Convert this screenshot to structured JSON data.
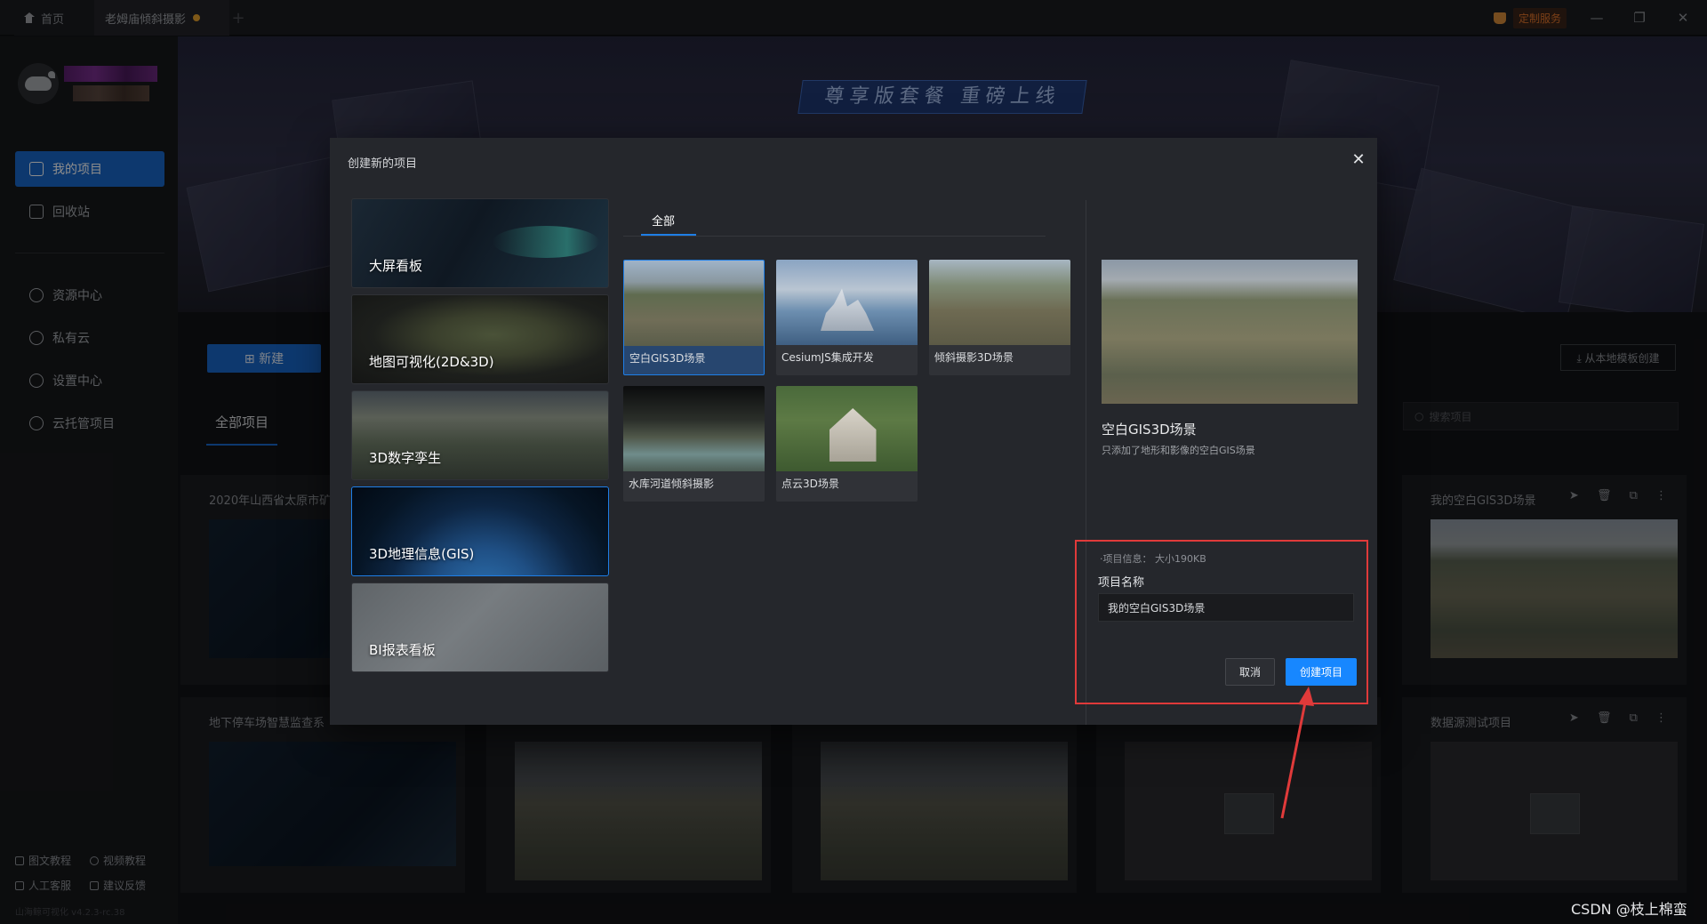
{
  "titlebar": {
    "home_tab": "首页",
    "doc_tab": "老姆庙倾斜摄影",
    "service_label": "定制服务",
    "min_icon": "—",
    "restore_icon": "❐",
    "close_icon": "✕",
    "accent_color": "#1966c9"
  },
  "sidebar": {
    "nav": [
      {
        "label": "我的项目",
        "icon": "monitor-icon"
      },
      {
        "label": "回收站",
        "icon": "trash-icon"
      },
      {
        "label": "资源中心",
        "icon": "cube-icon"
      },
      {
        "label": "私有云",
        "icon": "cloud-icon"
      },
      {
        "label": "设置中心",
        "icon": "gear-icon"
      },
      {
        "label": "云托管项目",
        "icon": "cloud-upload-icon"
      }
    ],
    "footer": {
      "tutorial_text": "图文教程",
      "tutorial_video": "视频教程",
      "support": "人工客服",
      "feedback": "建议反馈",
      "version": "山海鲸可视化 v4.2.3-rc.38"
    }
  },
  "banner": {
    "title": "尊享版套餐 重磅上线"
  },
  "main": {
    "new_button": "⊞ 新建",
    "template_button": "⤓ 从本地模板创建",
    "tab_all": "全部项目",
    "search_placeholder": "搜索项目",
    "projects": [
      {
        "title": "2020年山西省太原市矿"
      },
      {
        "title": "我的空白GIS3D场景"
      },
      {
        "title": "地下停车场智慧监查系"
      },
      {
        "title": "数据源测试项目"
      }
    ],
    "project_actions": "➤ 🗑 ⧉ ⋮"
  },
  "modal": {
    "title": "创建新的项目",
    "close_icon": "✕",
    "categories": [
      {
        "label": "大屏看板"
      },
      {
        "label": "地图可视化(2D&3D)"
      },
      {
        "label": "3D数字孪生"
      },
      {
        "label": "3D地理信息(GIS)"
      },
      {
        "label": "BI报表看板"
      }
    ],
    "filter_tab": "全部",
    "templates": [
      {
        "name": "空白GIS3D场景"
      },
      {
        "name": "CesiumJS集成开发"
      },
      {
        "name": "倾斜摄影3D场景"
      },
      {
        "name": "水库河道倾斜摄影"
      },
      {
        "name": "点云3D场景"
      }
    ],
    "preview": {
      "title": "空白GIS3D场景",
      "description": "只添加了地形和影像的空白GIS场景"
    },
    "info": "·项目信息：  大小190KB",
    "name_label": "项目名称",
    "name_value": "我的空白GIS3D场景",
    "cancel_button": "取消",
    "create_button": "创建项目"
  },
  "watermark": "CSDN @枝上棉蛮"
}
